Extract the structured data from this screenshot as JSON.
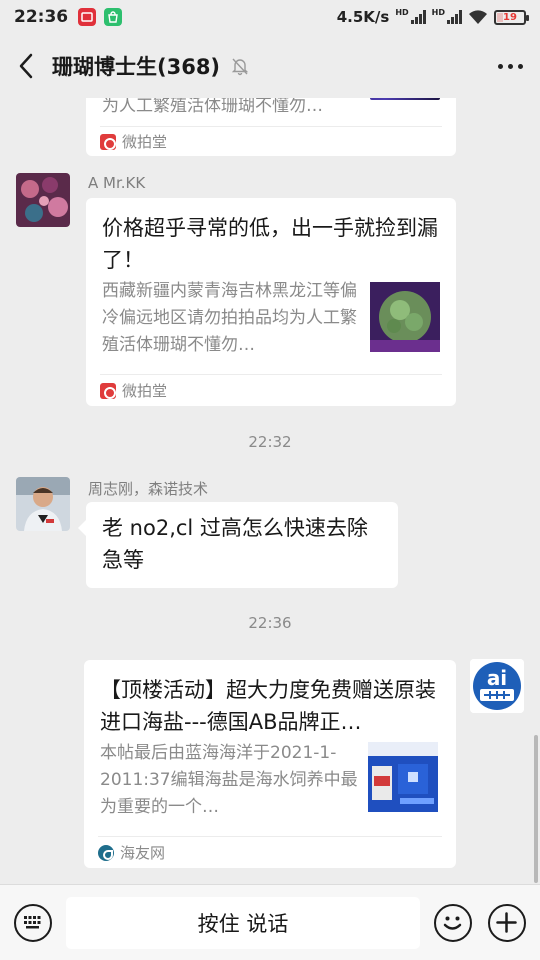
{
  "status_bar": {
    "time": "22:36",
    "network_speed": "4.5K/s",
    "hd1": "HD",
    "hd2": "HD",
    "battery": "19"
  },
  "header": {
    "title": "珊瑚博士生(368)"
  },
  "messages": {
    "card_top": {
      "desc_tail": "为人工繁殖活体珊瑚不懂勿…",
      "source": "微拍堂"
    },
    "msg1": {
      "sender": "A  Mr.KK",
      "title": "价格超乎寻常的低，出一手就捡到漏了！",
      "desc": "西藏新疆内蒙青海吉林黑龙江等偏冷偏远地区请勿拍拍品均为人工繁殖活体珊瑚不懂勿…",
      "source": "微拍堂"
    },
    "time1": "22:32",
    "msg2": {
      "sender": "周志刚，森诺技术",
      "text": "老 no2,cl 过高怎么快速去除急等"
    },
    "time2": "22:36",
    "msg3": {
      "title": "【顶楼活动】超大力度免费赠送原装进口海盐---德国AB品牌正…",
      "desc": "本帖最后由蓝海海洋于2021-1-2011:37编辑海盐是海水饲养中最为重要的一个…",
      "source": "海友网"
    }
  },
  "input_bar": {
    "hold_to_talk": "按住 说话"
  },
  "colors": {
    "background": "#ededed",
    "bubble": "#ffffff",
    "source_red": "#e03c3c",
    "battery_low": "#e53935"
  }
}
